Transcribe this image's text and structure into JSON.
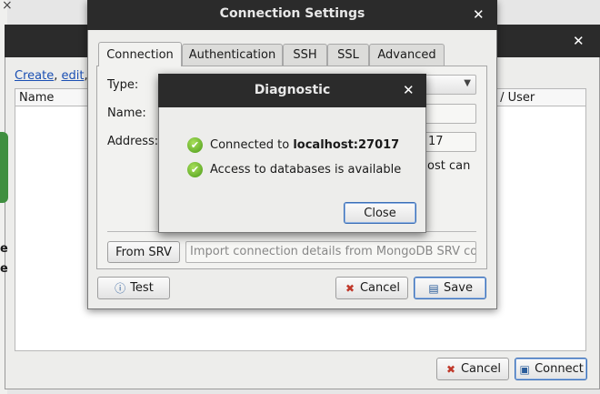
{
  "background_window": {
    "close_icon": "close-icon",
    "links": [
      "Create",
      "edit"
    ],
    "columns": {
      "name": "Name",
      "user": "e / User"
    },
    "buttons": {
      "cancel": "Cancel",
      "connect": "Connect"
    }
  },
  "connection_settings": {
    "title": "Connection Settings",
    "tabs": [
      "Connection",
      "Authentication",
      "SSH",
      "SSL",
      "Advanced"
    ],
    "labels": {
      "type": "Type:",
      "name": "Name:",
      "address": "Address:"
    },
    "address_port_fragment": "17",
    "hint_fragment": "ost can",
    "from_srv_label": "From SRV",
    "srv_placeholder": "Import connection details from MongoDB SRV con...",
    "buttons": {
      "test": "Test",
      "cancel": "Cancel",
      "save": "Save"
    }
  },
  "diagnostic": {
    "title": "Diagnostic",
    "messages": [
      {
        "prefix": "Connected to ",
        "bold": "localhost:27017",
        "icon": "check-icon"
      },
      {
        "prefix": "Access to databases is available",
        "bold": "",
        "icon": "check-icon"
      }
    ],
    "close_label": "Close"
  }
}
